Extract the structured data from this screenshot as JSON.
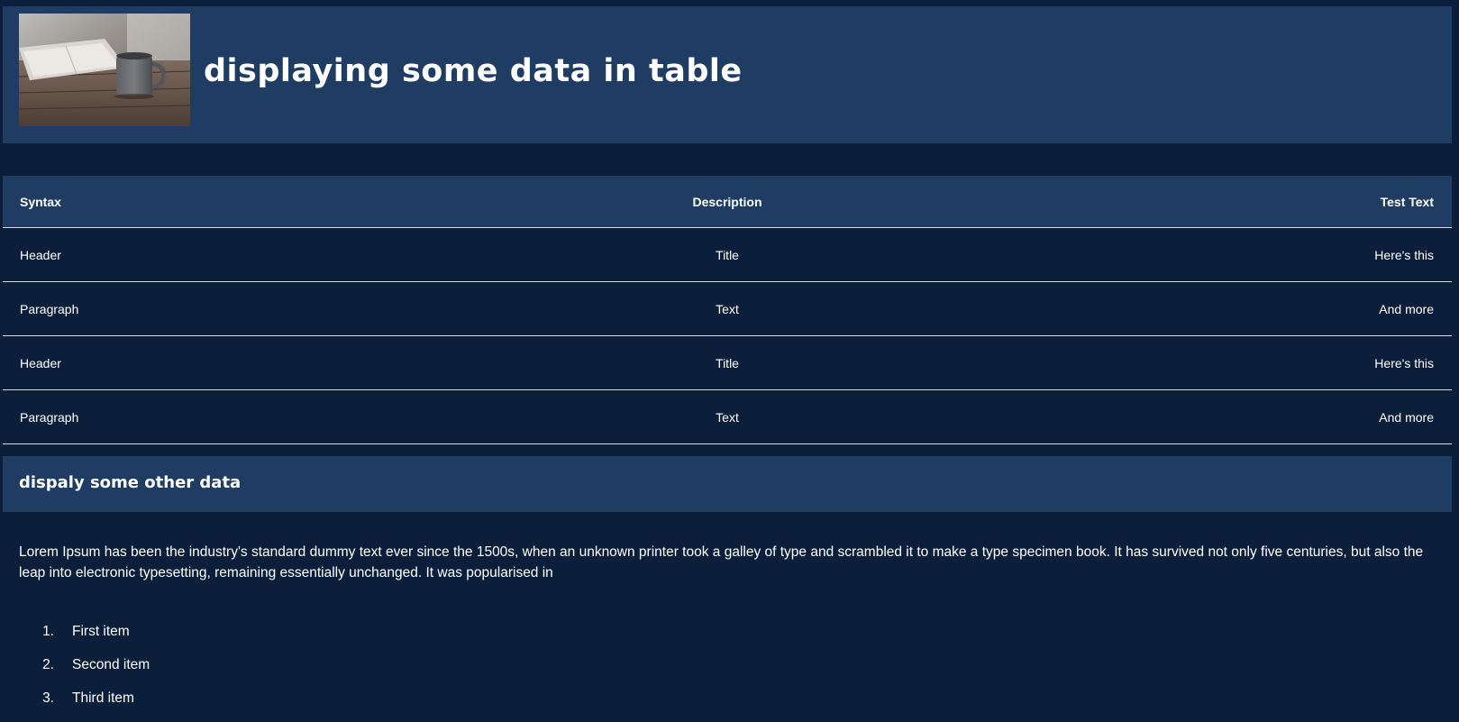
{
  "header": {
    "title": "displaying some data in table",
    "image": "coffee-mug-on-table"
  },
  "table": {
    "columns": [
      "Syntax",
      "Description",
      "Test Text"
    ],
    "rows": [
      [
        "Header",
        "Title",
        "Here's this"
      ],
      [
        "Paragraph",
        "Text",
        "And more"
      ],
      [
        "Header",
        "Title",
        "Here's this"
      ],
      [
        "Paragraph",
        "Text",
        "And more"
      ]
    ]
  },
  "section": {
    "title": "dispaly some other data"
  },
  "paragraph": "Lorem Ipsum has been the industry's standard dummy text ever since the 1500s, when an unknown printer took a galley of type and scrambled it to make a type specimen book. It has survived not only five centuries, but also the leap into electronic typesetting, remaining essentially unchanged. It was popularised in",
  "list": {
    "items": [
      {
        "number": "1.",
        "label": "First item"
      },
      {
        "number": "2.",
        "label": "Second item"
      },
      {
        "number": "3.",
        "label": "Third item"
      }
    ]
  },
  "colors": {
    "background": "#0b1f3a",
    "panel": "#1f3d63",
    "text": "#ffffff",
    "divider": "#d6dde7"
  }
}
